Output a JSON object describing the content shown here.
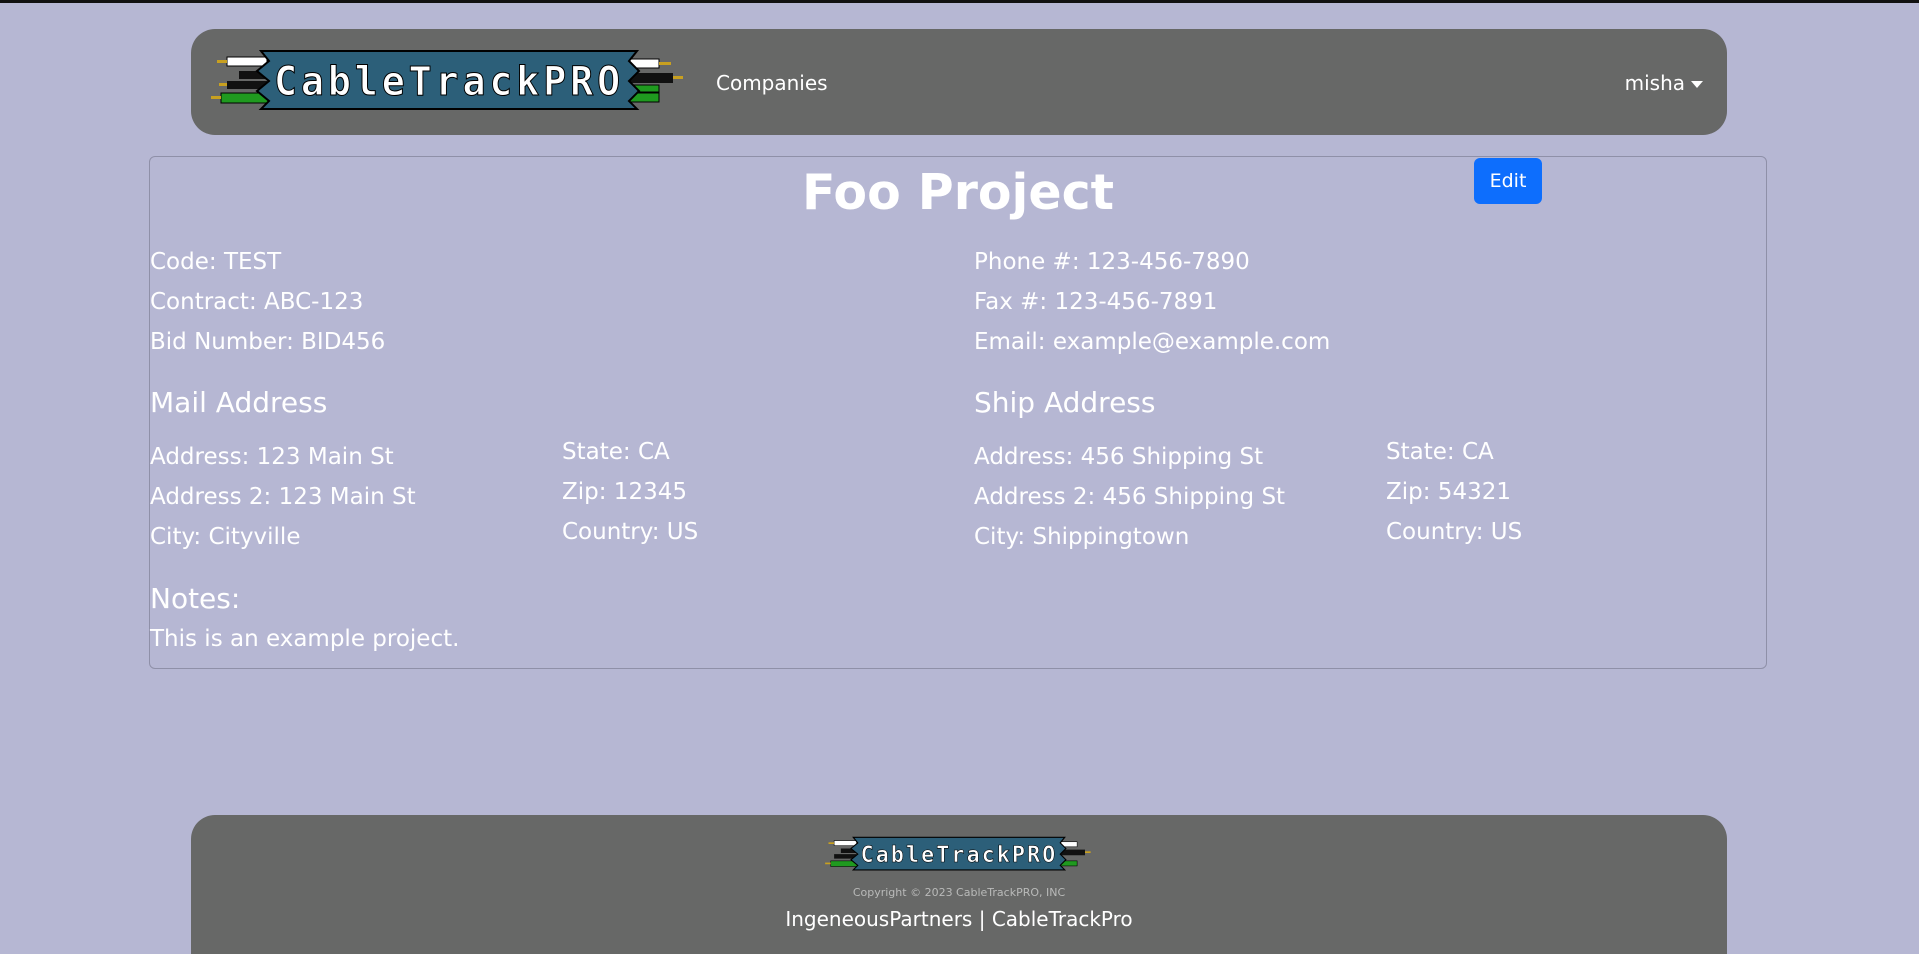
{
  "header": {
    "logo_text": "CableTrackPRO",
    "nav_companies": "Companies",
    "user_name": "misha"
  },
  "project": {
    "title": "Foo Project",
    "edit_label": "Edit",
    "code": "Code: TEST",
    "contract": "Contract: ABC-123",
    "bid_number": "Bid Number: BID456",
    "phone": "Phone #: 123-456-7890",
    "fax": "Fax #: 123-456-7891",
    "email": "Email: example@example.com"
  },
  "mail_address": {
    "heading": "Mail Address",
    "address": "Address: 123 Main St",
    "address2": "Address 2: 123 Main St",
    "city": "City: Cityville",
    "state": "State: CA",
    "zip": "Zip: 12345",
    "country": "Country: US"
  },
  "ship_address": {
    "heading": "Ship Address",
    "address": "Address: 456 Shipping St",
    "address2": "Address 2: 456 Shipping St",
    "city": "City: Shippingtown",
    "state": "State: CA",
    "zip": "Zip: 54321",
    "country": "Country: US"
  },
  "notes": {
    "heading": "Notes:",
    "text": "This is an example project."
  },
  "footer": {
    "logo_text": "CableTrackPRO",
    "copyright": "Copyright © 2023 CableTrackPRO, INC",
    "link_ingeneous": "IngeneousPartners",
    "separator": "|",
    "link_cabletrack": "CableTrackPro"
  },
  "colors": {
    "page_background": "#b6b7d3",
    "bar_background": "#676867",
    "edit_button": "#0d6efd",
    "logo_banner": "#2c5f79"
  }
}
